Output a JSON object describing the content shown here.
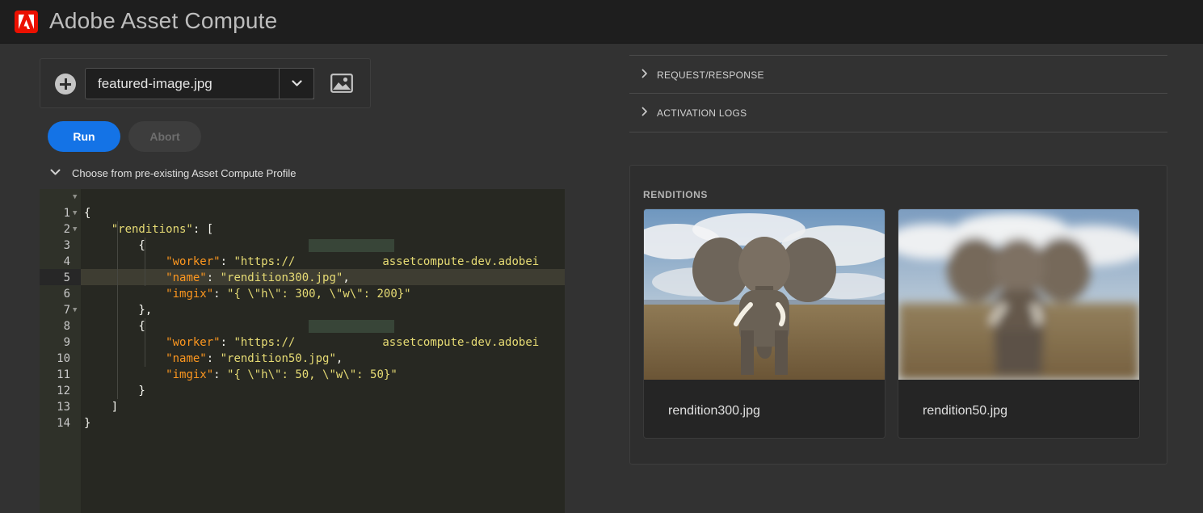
{
  "app": {
    "title": "Adobe Asset Compute"
  },
  "file_picker": {
    "selected_file": "featured-image.jpg"
  },
  "buttons": {
    "run": "Run",
    "abort": "Abort"
  },
  "profile": {
    "label": "Choose from pre-existing Asset Compute Profile"
  },
  "editor": {
    "active_line": 6,
    "line_numbers": [
      "1",
      "2",
      "3",
      "4",
      "5",
      "6",
      "7",
      "8",
      "9",
      "10",
      "11",
      "12",
      "13",
      "14"
    ],
    "lines": [
      "{",
      "    \"renditions\": [",
      "        {",
      "            \"worker\": \"https://",
      "            \"name\": \"rendition300.jpg\",",
      "            \"imgix\": \"{ \\\"h\\\": 300, \\\"w\\\": 200}\"",
      "        },",
      "        {",
      "            \"worker\": \"https://",
      "            \"name\": \"rendition50.jpg\",",
      "            \"imgix\": \"{ \\\"h\\\": 50, \\\"w\\\": 50}\"",
      "        }",
      "    ]",
      "}"
    ],
    "worker_url_tail": "assetcompute-dev.adobei"
  },
  "accordions": [
    "REQUEST/RESPONSE",
    "ACTIVATION LOGS"
  ],
  "renditions": {
    "title": "RENDITIONS",
    "items": [
      {
        "name": "rendition300.jpg",
        "image": "elephant-sharp"
      },
      {
        "name": "rendition50.jpg",
        "image": "elephant-blurred"
      }
    ]
  }
}
